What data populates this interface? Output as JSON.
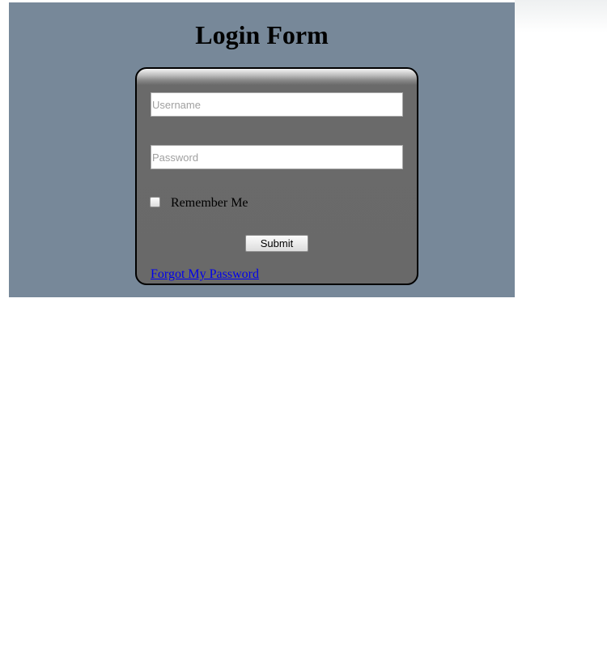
{
  "form": {
    "title": "Login Form",
    "username": {
      "placeholder": "Username",
      "value": ""
    },
    "password": {
      "placeholder": "Password",
      "value": ""
    },
    "remember_label": "Remember Me",
    "remember_checked": false,
    "submit_label": "Submit",
    "forgot_link": "Forgot My Password"
  },
  "colors": {
    "page_panel_bg": "#778899",
    "form_box_bg": "#696969",
    "link": "#0000ee"
  }
}
